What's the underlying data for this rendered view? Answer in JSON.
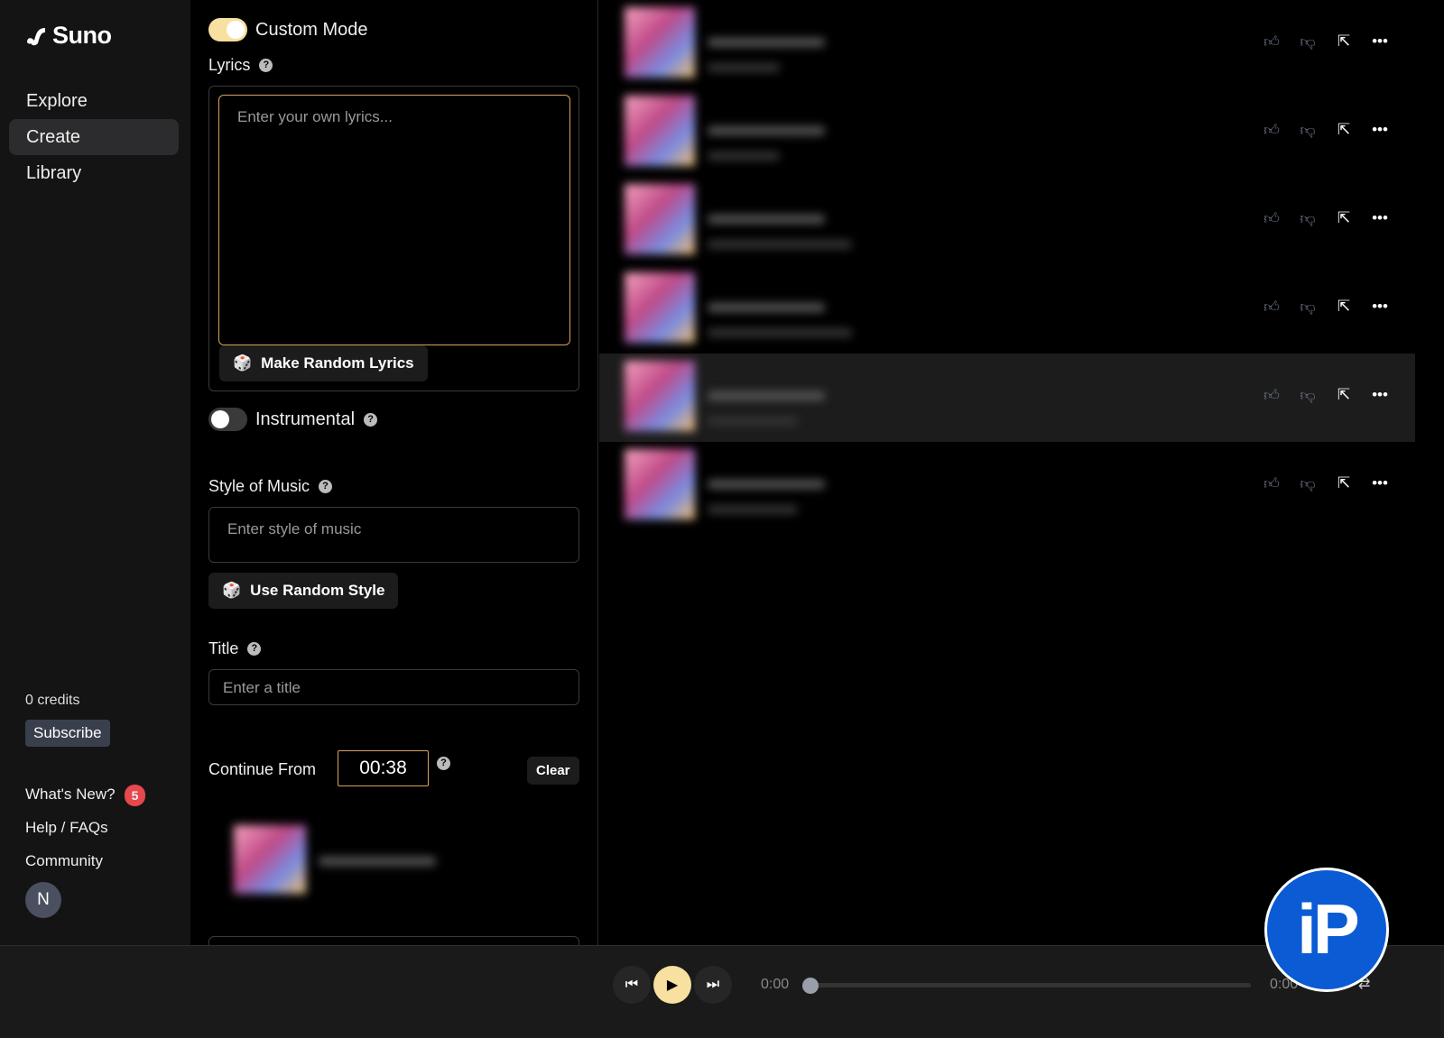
{
  "app": {
    "name": "Suno"
  },
  "sidebar": {
    "items": [
      {
        "label": "Explore"
      },
      {
        "label": "Create"
      },
      {
        "label": "Library"
      }
    ],
    "credits": "0 credits",
    "subscribe": "Subscribe",
    "whats_new": "What's New?",
    "whats_new_count": "5",
    "help": "Help / FAQs",
    "community": "Community",
    "avatar": "N"
  },
  "form": {
    "custom_mode": "Custom Mode",
    "custom_mode_on": true,
    "lyrics_label": "Lyrics",
    "lyrics_placeholder": "Enter your own lyrics...",
    "random_lyrics": "Make Random Lyrics",
    "instrumental": "Instrumental",
    "instrumental_on": false,
    "style_label": "Style of Music",
    "style_placeholder": "Enter style of music",
    "random_style": "Use Random Style",
    "title_label": "Title",
    "title_placeholder": "Enter a title",
    "continue_label": "Continue From",
    "continue_value": "00:38",
    "clear": "Clear"
  },
  "player": {
    "current": "0:00",
    "total": "0:00",
    "progress": 0
  },
  "colors": {
    "accent": "#f7e0a0",
    "highlight_border": "#d9a35a",
    "watermark": "#0a5bd4"
  },
  "watermark": "iP"
}
